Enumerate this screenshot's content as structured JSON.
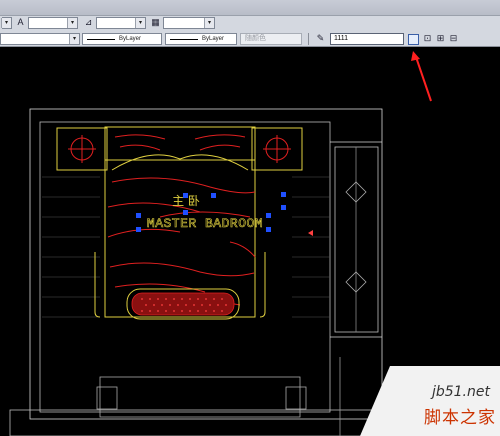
{
  "toolbar": {
    "layer_combo": "",
    "dimstyle_combo": "",
    "tablestyle_combo": "",
    "color_combo": "",
    "linetype_combo": "ByLayer",
    "lineweight_combo": "ByLayer",
    "plotstyle_combo": "随颜色",
    "block_name_field": "1111"
  },
  "drawing": {
    "room_name_cn": "主 卧",
    "room_name_en": "MASTER BADROOM"
  },
  "watermark": {
    "site": "jb51.net",
    "site_cn": "脚本之家"
  },
  "colors": {
    "canvas": "#000000",
    "furniture_lines": "#e0d040",
    "fabric_lines": "#e02020",
    "wall_lines": "#d8d8d8",
    "grip_squares": "#2050ff",
    "annotation_arrow": "#ff2020"
  }
}
